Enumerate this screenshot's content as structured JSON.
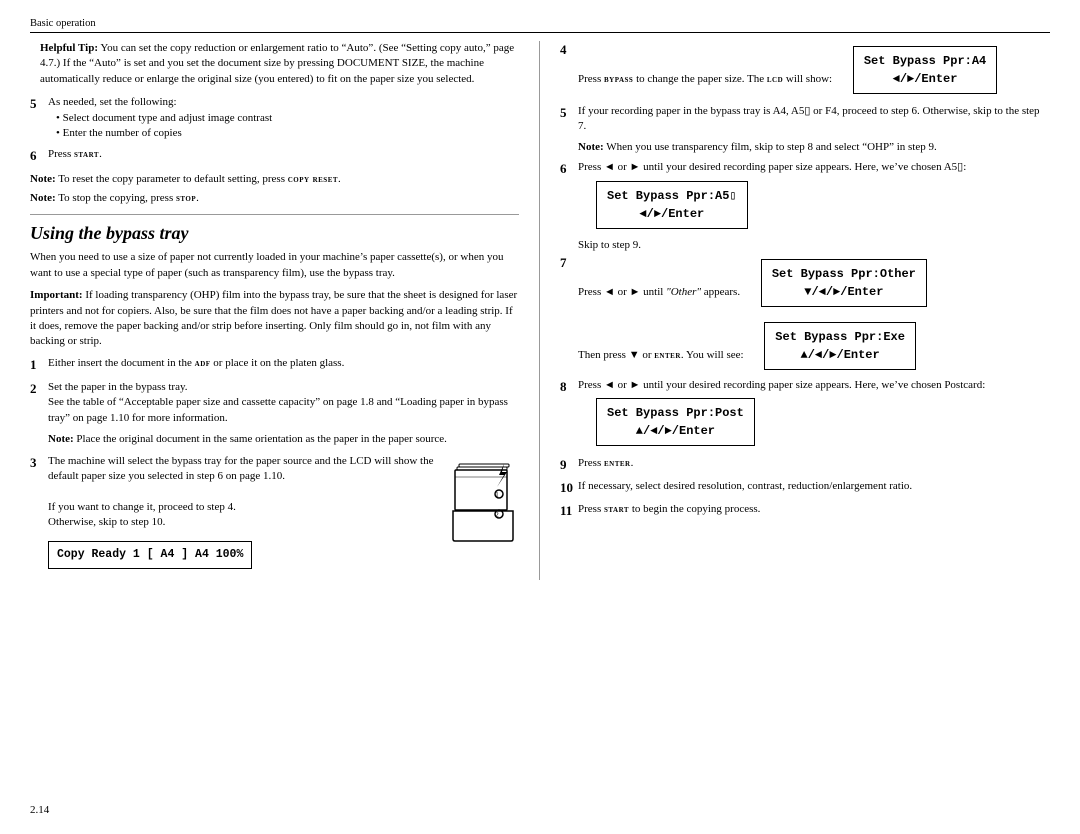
{
  "breadcrumb": "Basic operation",
  "helpful_tip": {
    "label": "Helpful Tip:",
    "text": "You can set the copy reduction or enlargement ratio to “Auto”. (See “Setting copy auto,” page 4.7.) If the “Auto” is set and you set the document size by pressing DOCUMENT SIZE, the machine automatically reduce or enlarge the original size (you entered) to fit on the paper size you selected."
  },
  "step5": {
    "num": "5",
    "intro": "As needed, set the following:",
    "bullets": [
      "Select document type and adjust image contrast",
      "Enter the number of copies"
    ]
  },
  "step6": {
    "num": "6",
    "text": "Press START."
  },
  "note1": {
    "label": "Note:",
    "text": "To reset the copy parameter to default setting, press COPY RESET."
  },
  "note2": {
    "label": "Note:",
    "text": "To stop the copying, press STOP."
  },
  "section_heading": "Using the bypass tray",
  "section_intro": "When you need to use a size of paper not currently loaded in your machine’s paper cassette(s), or when you want to use a special type of paper (such as transparency film), use the bypass tray.",
  "important": {
    "label": "Important:",
    "text": "If loading transparency (OHP) film into the bypass tray, be sure that the sheet is designed for laser printers and not for copiers. Also, be sure that the film does not have a paper backing and/or a leading strip. If it does, remove the paper backing and/or strip before inserting. Only film should go in, not film with any backing or strip."
  },
  "step1": {
    "num": "1",
    "text": "Either insert the document in the ADF or place it on the platen glass."
  },
  "step2": {
    "num": "2",
    "intro": "Set the paper in the bypass tray.",
    "detail": "See the table of “Acceptable paper size and cassette capacity” on page 1.8 and “Loading paper in bypass tray” on page 1.10 for more information."
  },
  "note3": {
    "label": "Note:",
    "text": "Place the original document in the same orientation as the paper in the paper source."
  },
  "step3": {
    "num": "3",
    "text": "The machine will select the bypass tray for the paper source and the LCD will show the default paper size you selected in step 6 on page 1.10.",
    "subtext": "If you want to change it, proceed to step 4.\nOtherwise, skip to step 10."
  },
  "copy_ready": {
    "line1": "Copy Ready         1",
    "line2": "[ A4 ]    A4   100%"
  },
  "right_step4": {
    "num": "4",
    "text": "Press BYPASS to change the paper size. The LCD will show:",
    "lcd": {
      "line1": "Set Bypass Ppr:A4",
      "line2": "◄/►/Enter"
    }
  },
  "right_step5": {
    "num": "5",
    "text": "If your recording paper in the bypass tray is A4, A5▯ or F4, proceed to step 6. Otherwise, skip to the step 7."
  },
  "right_note1": {
    "label": "Note:",
    "text": "When you use transparency film, skip to step 8 and select “OHP” in step 9."
  },
  "right_step6": {
    "num": "6",
    "text": "Press ◄ or ► until your desired recording paper size appears. Here, we’ve chosen A5▯:",
    "lcd": {
      "line1": "Set Bypass Ppr:A5▯",
      "line2": "◄/►/Enter"
    }
  },
  "skip_text": "Skip to step 9.",
  "right_step7": {
    "num": "7",
    "text": "Press ◄ or ► until “Other” appears.",
    "lcd": {
      "line1": "Set Bypass Ppr:Other",
      "line2": "▼/◄/►/Enter"
    }
  },
  "then_press": "Then press ▼ or ENTER. You will see:",
  "lcd_exe": {
    "line1": "Set Bypass Ppr:Exe",
    "line2": "▲/◄/►/Enter"
  },
  "right_step8": {
    "num": "8",
    "text": "Press ◄ or ► until your desired recording paper size appears. Here, we’ve chosen Postcard:",
    "lcd": {
      "line1": "Set Bypass Ppr:Post",
      "line2": "▲/◄/►/Enter"
    }
  },
  "right_step9": {
    "num": "9",
    "text": "Press ENTER."
  },
  "right_step10": {
    "num": "10",
    "text": "If necessary, select desired resolution, contrast, reduction/enlargement ratio."
  },
  "right_step11": {
    "num": "11",
    "text": "Press START to begin the copying process."
  },
  "footer": "2.14"
}
